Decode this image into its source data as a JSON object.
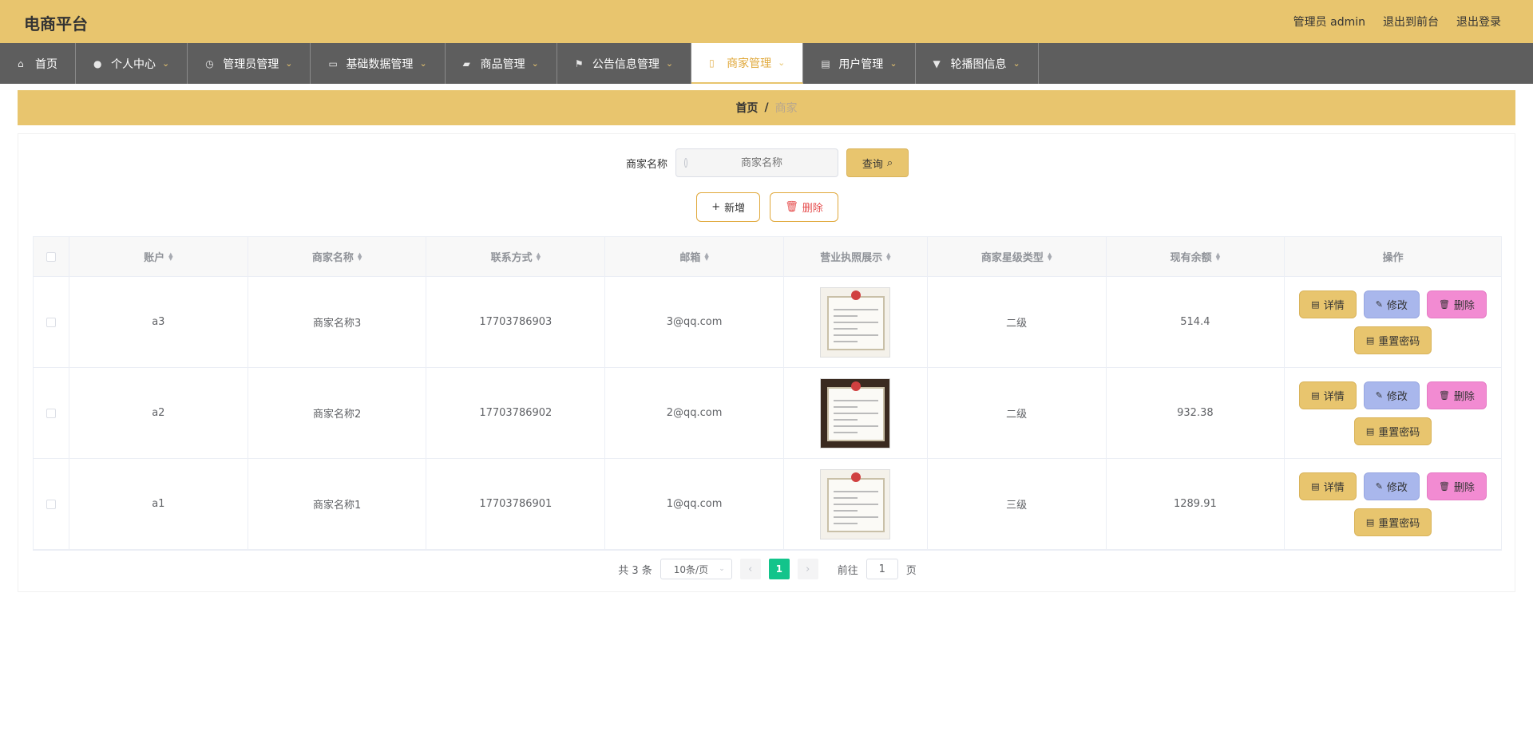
{
  "header": {
    "title": "电商平台",
    "user_label": "管理员 admin",
    "to_front": "退出到前台",
    "logout": "退出登录"
  },
  "nav": {
    "items": [
      {
        "label": "首页",
        "icon": "home-icon"
      },
      {
        "label": "个人中心",
        "icon": "user-icon"
      },
      {
        "label": "管理员管理",
        "icon": "clock-icon"
      },
      {
        "label": "基础数据管理",
        "icon": "monitor-icon"
      },
      {
        "label": "商品管理",
        "icon": "goods-icon"
      },
      {
        "label": "公告信息管理",
        "icon": "flag-icon"
      },
      {
        "label": "商家管理",
        "icon": "phone-icon"
      },
      {
        "label": "用户管理",
        "icon": "briefcase-icon"
      },
      {
        "label": "轮播图信息",
        "icon": "sign-icon"
      }
    ],
    "active_index": 6
  },
  "breadcrumb": {
    "home": "首页",
    "separator": "/",
    "current": "商家"
  },
  "search": {
    "label": "商家名称",
    "placeholder": "商家名称",
    "query_button": "查询"
  },
  "actions": {
    "add": "新增",
    "delete": "删除"
  },
  "table": {
    "columns": [
      "账户",
      "商家名称",
      "联系方式",
      "邮箱",
      "营业执照展示",
      "商家星级类型",
      "现有余额",
      "操作"
    ],
    "rows": [
      {
        "account": "a3",
        "name": "商家名称3",
        "phone": "17703786903",
        "email": "3@qq.com",
        "star": "二级",
        "balance": "514.4"
      },
      {
        "account": "a2",
        "name": "商家名称2",
        "phone": "17703786902",
        "email": "2@qq.com",
        "star": "二级",
        "balance": "932.38"
      },
      {
        "account": "a1",
        "name": "商家名称1",
        "phone": "17703786901",
        "email": "1@qq.com",
        "star": "三级",
        "balance": "1289.91"
      }
    ],
    "row_actions": {
      "detail": "详情",
      "edit": "修改",
      "delete": "删除",
      "reset_password": "重置密码"
    }
  },
  "pagination": {
    "total": "共 3 条",
    "page_size": "10条/页",
    "current_page": "1",
    "goto_prefix": "前往",
    "goto_value": "1",
    "goto_suffix": "页"
  },
  "colors": {
    "accent": "#e8c56e",
    "nav_bg": "#5e5e5e",
    "page_active": "#13c48b",
    "edit_btn": "#a9b7ec",
    "delete_btn": "#f28bd2"
  }
}
